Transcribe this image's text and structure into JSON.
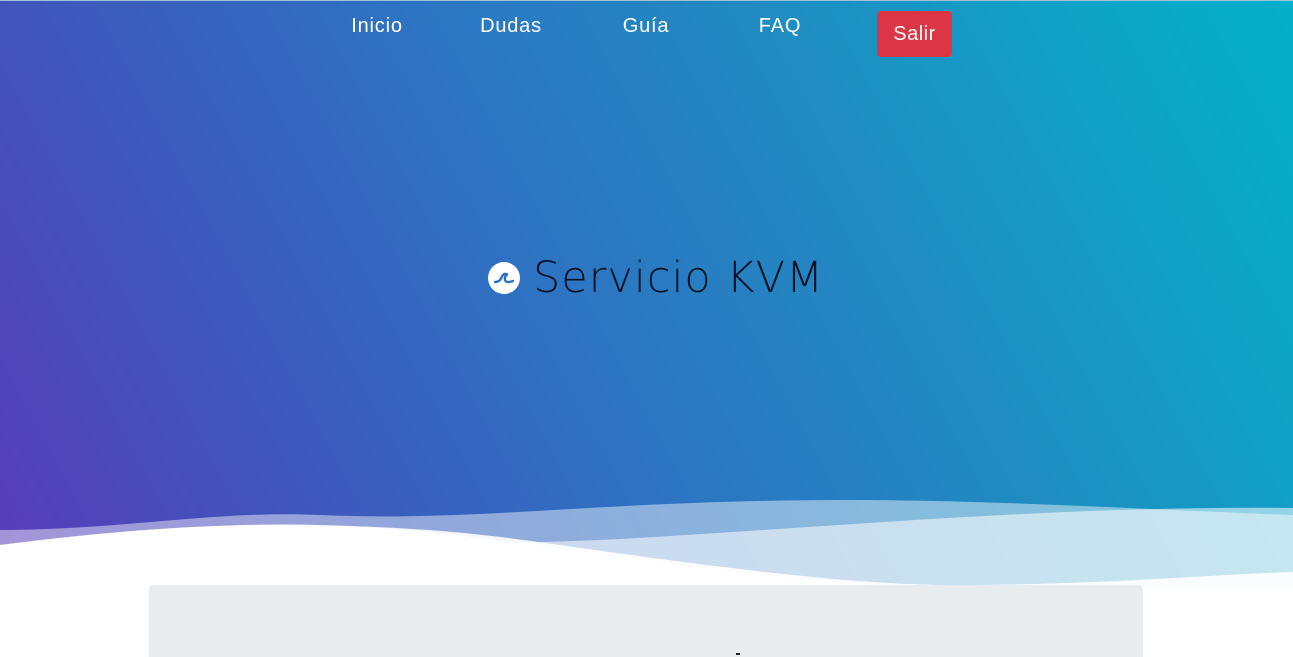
{
  "nav": {
    "items": [
      {
        "label": "Inicio"
      },
      {
        "label": "Dudas"
      },
      {
        "label": "Guía"
      },
      {
        "label": "FAQ"
      }
    ],
    "logout_label": "Salir"
  },
  "hero": {
    "title": "Servicio KVM",
    "icon": "wave-logo-icon"
  },
  "colors": {
    "gradient_start": "#5a3ab8",
    "gradient_end": "#03b0c9",
    "logout_button": "#dc3545",
    "card_background": "#e9ecef"
  }
}
